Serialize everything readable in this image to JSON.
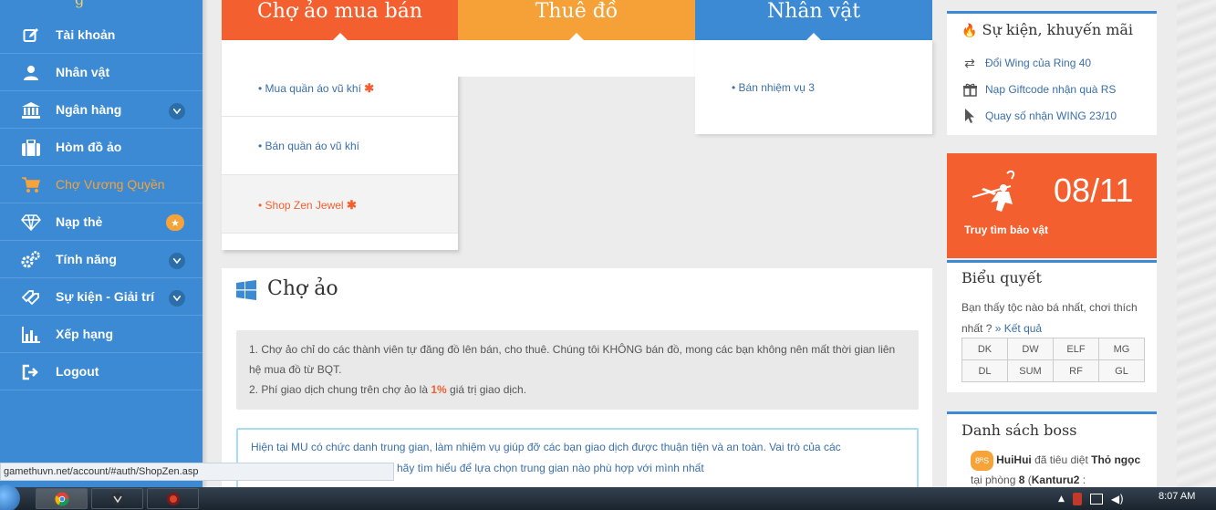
{
  "sidebar": {
    "logo_fragment": "g",
    "items": [
      {
        "label": "Tài khoản",
        "icon": "edit-icon"
      },
      {
        "label": "Nhân vật",
        "icon": "user-icon"
      },
      {
        "label": "Ngân hàng",
        "icon": "bank-icon"
      },
      {
        "label": "Hòm đồ ảo",
        "icon": "briefcase-icon"
      },
      {
        "label": "Chợ Vương Quyền",
        "icon": "cart-icon"
      },
      {
        "label": "Nạp thẻ",
        "icon": "diamond-icon"
      },
      {
        "label": "Tính năng",
        "icon": "gears-icon"
      },
      {
        "label": "Sự kiện - Giải trí",
        "icon": "tag-icon"
      },
      {
        "label": "Xếp hạng",
        "icon": "bar-chart-icon"
      },
      {
        "label": "Logout",
        "icon": "logout-icon"
      }
    ],
    "active_index": 4
  },
  "tabs": [
    {
      "label": "Chợ ảo mua bán"
    },
    {
      "label": "Thuê đồ"
    },
    {
      "label": "Nhân vật"
    }
  ],
  "buy_menu": [
    {
      "label": "• Mua quần áo vũ khí",
      "flag": "✱"
    },
    {
      "label": "• Bán quần áo vũ khí"
    },
    {
      "label": "• Shop Zen Jewel",
      "flag": "✱"
    }
  ],
  "char_menu": [
    {
      "label": "• Bán nhiệm vụ 3"
    }
  ],
  "main": {
    "title": "Chợ ảo",
    "note_line1": "1. Chợ ảo chỉ do các thành viên tự đăng đồ lên bán, cho thuê. Chúng tôi KHÔNG bán đồ, mong các bạn không nên mất thời gian liên hệ mua đồ từ BQT.",
    "note_line2_pre": "2. Phí giao dịch chung trên chợ ảo là ",
    "note_line2_hl": "1%",
    "note_line2_post": " giá trị giao dịch.",
    "info_line1": "Hiện tại MU có chức danh trung gian, làm nhiệm vụ giúp đỡ các bạn giao dịch được thuận tiện và an toàn. Vai trò của các",
    "info_line2": "n hãy tìm hiểu để lựa chọn trung gian nào phù hợp với mình nhất"
  },
  "events": {
    "title": "Sự kiện, khuyến mãi",
    "items": [
      {
        "label": "Đổi Wing của Ring 40",
        "icon": "exchange-icon"
      },
      {
        "label": "Nạp Giftcode nhận quà RS",
        "icon": "gift-icon"
      },
      {
        "label": "Quay số nhận WING 23/10",
        "icon": "cursor-icon"
      }
    ]
  },
  "promo": {
    "date": "08/11",
    "caption": "Truy tìm bảo vật"
  },
  "vote": {
    "title": "Biểu quyết",
    "question": "Bạn thấy tộc nào bá nhất, chơi thích nhất ?",
    "result_link": "» Kết quả",
    "options": [
      "DK",
      "DW",
      "ELF",
      "MG",
      "DL",
      "SUM",
      "RF",
      "GL"
    ]
  },
  "boss": {
    "title": "Danh sách boss",
    "badge": "8ᴿS",
    "killer": "HuiHui",
    "text1": " đã tiêu diệt ",
    "boss_name": "Thỏ ngọc",
    "text2": " tại phòng ",
    "room": "8",
    "text3": " (",
    "map": "Kanturu2",
    "text4": " :"
  },
  "statusbar": {
    "url": "gamethuvn.net/account/#auth/ShopZen.asp"
  },
  "taskbar": {
    "clock": "8:07 AM"
  },
  "colors": {
    "blue": "#3b8ad3",
    "orange_red": "#f45f2f",
    "orange": "#f5a138"
  }
}
